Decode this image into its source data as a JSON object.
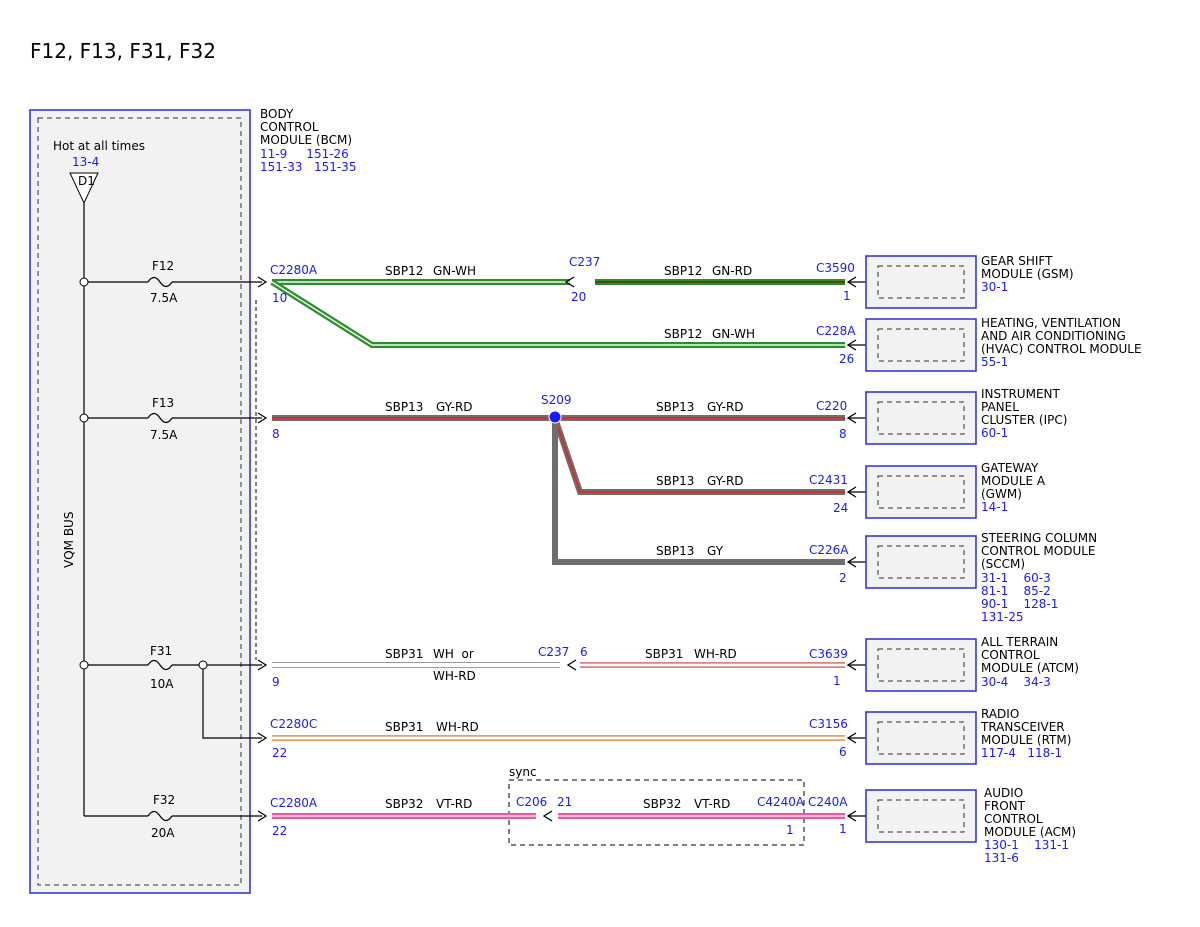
{
  "page": {
    "title": "F12, F13, F31, F32"
  },
  "vqm": {
    "bus_label": "VQM BUS",
    "hot_label": "Hot at all times",
    "hot_ref": "13-4",
    "source_label": "D1"
  },
  "bcm": {
    "name_lines": [
      "BODY",
      "CONTROL",
      "MODULE (BCM)"
    ],
    "ref_line1": "11-9     151-26",
    "ref_line2": "151-33   151-35"
  },
  "fuses": {
    "f12": {
      "name": "F12",
      "rating": "7.5A"
    },
    "f13": {
      "name": "F13",
      "rating": "7.5A"
    },
    "f31": {
      "name": "F31",
      "rating": "10A"
    },
    "f32": {
      "name": "F32",
      "rating": "20A"
    }
  },
  "connectors": {
    "c2280a_top": "C2280A",
    "c2280a_top_pin": "10",
    "f13_pin": "8",
    "f31_pin": "9",
    "c2280c": "C2280C",
    "c2280c_pin": "22",
    "c2280a_bot": "C2280A",
    "c2280a_bot_pin": "22",
    "c237_top": "C237",
    "c237_top_pin": "20",
    "c237_mid": "C237",
    "c237_mid_pin": "6",
    "s209": "S209",
    "c206": "C206",
    "c206_pin": "21",
    "c4240a": "C4240A",
    "c4240a_pin": "1",
    "c3590": "C3590",
    "c3590_pin": "1",
    "c228a": "C228A",
    "c228a_pin": "26",
    "c220": "C220",
    "c220_pin": "8",
    "c2431": "C2431",
    "c2431_pin": "24",
    "c226a": "C226A",
    "c226a_pin": "2",
    "c3639": "C3639",
    "c3639_pin": "1",
    "c3156": "C3156",
    "c3156_pin": "6",
    "c240a": "C240A",
    "c240a_pin": "1"
  },
  "wires": {
    "w1": {
      "circuit": "SBP12",
      "color": "GN-WH"
    },
    "w2": {
      "circuit": "SBP12",
      "color": "GN-RD"
    },
    "w3": {
      "circuit": "SBP12",
      "color": "GN-WH"
    },
    "w4": {
      "circuit": "SBP13",
      "color": "GY-RD"
    },
    "w5": {
      "circuit": "SBP13",
      "color": "GY-RD"
    },
    "w6": {
      "circuit": "SBP13",
      "color": "GY-RD"
    },
    "w7": {
      "circuit": "SBP13",
      "color": "GY"
    },
    "w8": {
      "circuit": "SBP31",
      "color": "WH  or",
      "color2": "WH-RD"
    },
    "w9": {
      "circuit": "SBP31",
      "color": "WH-RD"
    },
    "w10": {
      "circuit": "SBP31",
      "color": "WH-RD"
    },
    "w11": {
      "circuit": "SBP32",
      "color": "VT-RD"
    },
    "w12": {
      "circuit": "SBP32",
      "color": "VT-RD"
    }
  },
  "sync_label": "sync",
  "modules": {
    "gsm": {
      "lines": [
        "GEAR SHIFT",
        "MODULE (GSM)"
      ],
      "refs": [
        "30-1"
      ]
    },
    "hvac": {
      "lines": [
        "HEATING, VENTILATION",
        "AND AIR CONDITIONING",
        "(HVAC) CONTROL MODULE"
      ],
      "refs": [
        "55-1"
      ]
    },
    "ipc": {
      "lines": [
        "INSTRUMENT",
        "PANEL",
        "CLUSTER (IPC)"
      ],
      "refs": [
        "60-1"
      ]
    },
    "gwm": {
      "lines": [
        "GATEWAY",
        "MODULE A",
        "(GWM)"
      ],
      "refs": [
        "14-1"
      ]
    },
    "sccm": {
      "lines": [
        "STEERING COLUMN",
        "CONTROL MODULE",
        "(SCCM)"
      ],
      "refs": [
        "31-1    60-3",
        "81-1    85-2",
        "90-1    128-1",
        "131-25"
      ]
    },
    "atcm": {
      "lines": [
        "ALL TERRAIN",
        "CONTROL",
        "MODULE (ATCM)"
      ],
      "refs": [
        "30-4    34-3"
      ]
    },
    "rtm": {
      "lines": [
        "RADIO",
        "TRANSCEIVER",
        "MODULE (RTM)"
      ],
      "refs": [
        "117-4   118-1"
      ]
    },
    "acm": {
      "lines": [
        "AUDIO",
        "FRONT",
        "CONTROL",
        "MODULE (ACM)"
      ],
      "refs": [
        "130-1    131-1",
        "131-6"
      ]
    }
  },
  "colors": {
    "frame_blue": "#2b2bd6",
    "text_blue": "#1a1aff",
    "green": "#2e8b2e",
    "dark_olive": "#4a4a10",
    "gray": "#6e6e6e",
    "red": "#d03030",
    "pink": "#e85aa0",
    "panel_fill": "#f2f2f2"
  }
}
